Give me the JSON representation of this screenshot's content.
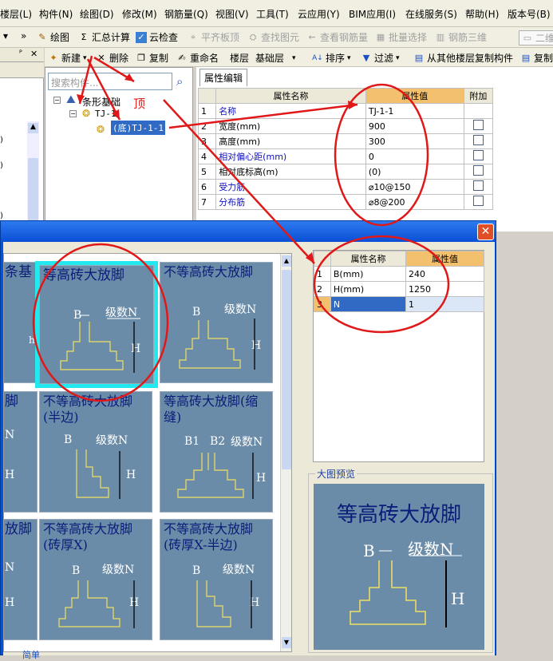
{
  "menubar": {
    "items": [
      "楼层(L)",
      "构件(N)",
      "绘图(D)",
      "修改(M)",
      "钢筋量(Q)",
      "视图(V)",
      "工具(T)",
      "云应用(Y)",
      "BIM应用(I)",
      "在线服务(S)",
      "帮助(H)",
      "版本号(B)"
    ]
  },
  "toolbar1": {
    "items": [
      "绘图",
      "汇总计算",
      "云检查",
      "平齐板顶",
      "查找图元",
      "查看钢筋量",
      "批量选择",
      "钢筋三维",
      "二维"
    ]
  },
  "toolbar2": {
    "new": "新建",
    "delete": "删除",
    "copy": "复制",
    "rename": "重命名",
    "floor_label": "楼层",
    "floor_value": "基础层",
    "sort": "排序",
    "filter": "过滤",
    "copy_from_floor": "从其他楼层复制构件",
    "copy2": "复制"
  },
  "tree": {
    "search_placeholder": "搜索构件...",
    "root": "条形基础",
    "child": "TJ-1",
    "leaf": "(底)TJ-1-1",
    "annotation": "顶"
  },
  "propTop": {
    "tab": "属性编辑",
    "headers": [
      "属性名称",
      "属性值",
      "附加"
    ],
    "rows": [
      {
        "n": "1",
        "name": "名称",
        "value": "TJ-1-1",
        "blue": true,
        "cb": false
      },
      {
        "n": "2",
        "name": "宽度(mm)",
        "value": "900",
        "blue": false,
        "cb": true
      },
      {
        "n": "3",
        "name": "高度(mm)",
        "value": "300",
        "blue": false,
        "cb": true
      },
      {
        "n": "4",
        "name": "相对偏心距(mm)",
        "value": "0",
        "blue": true,
        "cb": true
      },
      {
        "n": "5",
        "name": "相对底标高(m)",
        "value": "(0)",
        "blue": false,
        "cb": true
      },
      {
        "n": "6",
        "name": "受力筋",
        "value": "⌀10@150",
        "blue": true,
        "cb": true
      },
      {
        "n": "7",
        "name": "分布筋",
        "value": "⌀8@200",
        "blue": true,
        "cb": true
      }
    ]
  },
  "thumbs": {
    "t1": "条基",
    "t2": "等高砖大放脚",
    "t3": "不等高砖大放脚",
    "t4": "脚",
    "t5": "不等高砖大放脚(半边)",
    "t6": "等高砖大放脚(缩缝)",
    "t7": "放脚",
    "t8": "不等高砖大放脚(砖厚X)",
    "t9": "不等高砖大放脚(砖厚X-半边)",
    "label_B": "B",
    "label_B1": "B1",
    "label_B2": "B2",
    "label_N": "级数N",
    "label_H": "H",
    "label_h": "h"
  },
  "propDlg": {
    "headers": [
      "属性名称",
      "属性值"
    ],
    "rows": [
      {
        "n": "1",
        "name": "B(mm)",
        "value": "240"
      },
      {
        "n": "2",
        "name": "H(mm)",
        "value": "1250"
      },
      {
        "n": "3",
        "name": "N",
        "value": "1"
      }
    ]
  },
  "preview": {
    "title": "大图预览",
    "label": "等高砖大放脚"
  },
  "bottom_tab": "简单",
  "dialog_close": "✕"
}
